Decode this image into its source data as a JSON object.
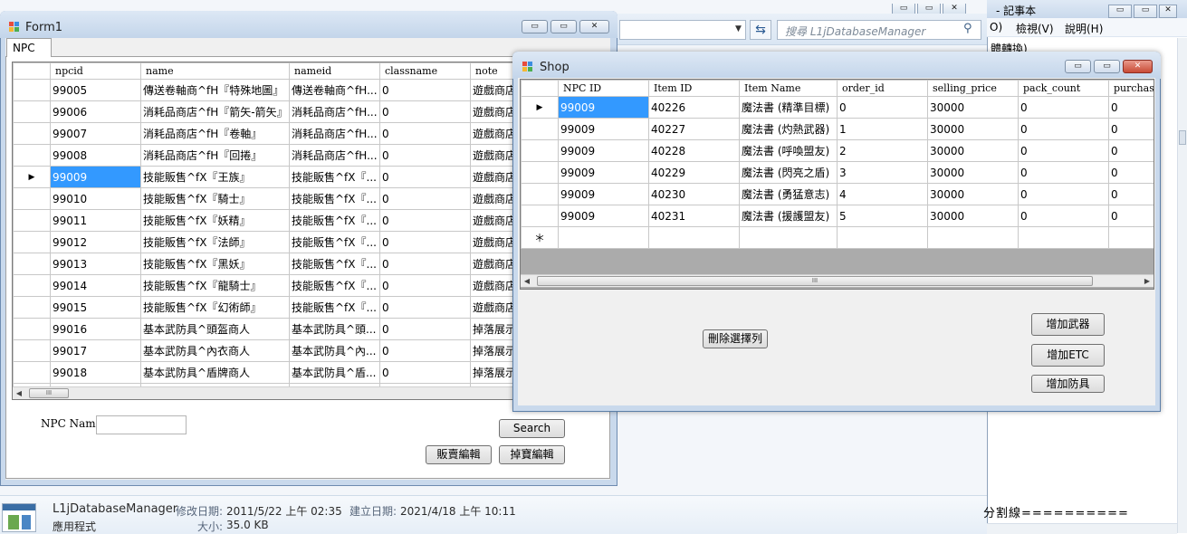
{
  "explorer": {
    "search_placeholder": "搜尋 L1jDatabaseManager",
    "dropdown_glyph": "▼",
    "refresh_glyph": "⇆",
    "search_glyph": "⚲",
    "details": {
      "name": "L1jDatabaseManager",
      "type": "應用程式",
      "modified_label": "修改日期:",
      "modified_value": "2011/5/22 上午 02:35",
      "created_label": "建立日期:",
      "created_value": "2021/4/18 上午 10:11",
      "size_label": "大小:",
      "size_value": "35.0 KB"
    }
  },
  "notepad": {
    "title": "- 記事本",
    "menu_o": "O)",
    "menu_view": "檢視(V)",
    "menu_help": "說明(H)",
    "line1": "體轉換)",
    "line2": "分割線==========",
    "controls": [
      "▭",
      "▭",
      "✕"
    ]
  },
  "form1": {
    "title": "Form1",
    "controls": [
      "▭",
      "▭",
      "✕"
    ],
    "tab_label": "NPC",
    "columns": [
      "npcid",
      "name",
      "nameid",
      "classname",
      "note"
    ],
    "rows": [
      [
        "99005",
        "傳送卷軸商^fH『特殊地圖』",
        "傳送卷軸商^fH...",
        "0",
        "遊戲商店"
      ],
      [
        "99006",
        "消耗品商店^fH『箭矢-箭矢』",
        "消耗品商店^fH...",
        "0",
        "遊戲商店"
      ],
      [
        "99007",
        "消耗品商店^fH『卷軸』",
        "消耗品商店^fH...",
        "0",
        "遊戲商店"
      ],
      [
        "99008",
        "消耗品商店^fH『回捲』",
        "消耗品商店^fH...",
        "0",
        "遊戲商店"
      ],
      [
        "99009",
        "技能販售^fX『王族』",
        "技能販售^fX『...",
        "0",
        "遊戲商店"
      ],
      [
        "99010",
        "技能販售^fX『騎士』",
        "技能販售^fX『...",
        "0",
        "遊戲商店"
      ],
      [
        "99011",
        "技能販售^fX『妖精』",
        "技能販售^fX『...",
        "0",
        "遊戲商店"
      ],
      [
        "99012",
        "技能販售^fX『法師』",
        "技能販售^fX『...",
        "0",
        "遊戲商店"
      ],
      [
        "99013",
        "技能販售^fX『黑妖』",
        "技能販售^fX『...",
        "0",
        "遊戲商店"
      ],
      [
        "99014",
        "技能販售^fX『龍騎士』",
        "技能販售^fX『...",
        "0",
        "遊戲商店"
      ],
      [
        "99015",
        "技能販售^fX『幻術師』",
        "技能販售^fX『...",
        "0",
        "遊戲商店"
      ],
      [
        "99016",
        "基本武防具^頭盔商人",
        "基本武防具^頭...",
        "0",
        "掉落展示"
      ],
      [
        "99017",
        "基本武防具^內衣商人",
        "基本武防具^內...",
        "0",
        "掉落展示"
      ],
      [
        "99018",
        "基本武防具^盾牌商人",
        "基本武防具^盾...",
        "0",
        "掉落展示"
      ],
      [
        "",
        "",
        "",
        "",
        ""
      ]
    ],
    "current_row_marker": "▶",
    "scroll_left": "◀",
    "scroll_thumb": "III",
    "npc_name_label": "NPC Name",
    "npc_name_value": "",
    "search_button": "Search",
    "sell_edit_button": "販賣編輯",
    "drop_edit_button": "掉寶編輯"
  },
  "shop": {
    "title": "Shop",
    "controls": [
      "▭",
      "▭",
      "✕"
    ],
    "columns": [
      "NPC ID",
      "Item ID",
      "Item Name",
      "order_id",
      "selling_price",
      "pack_count",
      "purchasin"
    ],
    "rows": [
      [
        "99009",
        "40226",
        "魔法書 (精準目標)",
        "0",
        "30000",
        "0",
        "0"
      ],
      [
        "99009",
        "40227",
        "魔法書 (灼熱武器)",
        "1",
        "30000",
        "0",
        "0"
      ],
      [
        "99009",
        "40228",
        "魔法書 (呼喚盟友)",
        "2",
        "30000",
        "0",
        "0"
      ],
      [
        "99009",
        "40229",
        "魔法書 (閃亮之盾)",
        "3",
        "30000",
        "0",
        "0"
      ],
      [
        "99009",
        "40230",
        "魔法書 (勇猛意志)",
        "4",
        "30000",
        "0",
        "0"
      ],
      [
        "99009",
        "40231",
        "魔法書 (援護盟友)",
        "5",
        "30000",
        "0",
        "0"
      ]
    ],
    "current_row_marker": "▶",
    "new_row_marker": "＊",
    "scroll_left": "◀",
    "scroll_right": "▶",
    "scroll_thumb": "III",
    "delete_button": "刪除選擇列",
    "add_weapon_button": "增加武器",
    "add_etc_button": "增加ETC",
    "add_armor_button": "增加防具"
  }
}
